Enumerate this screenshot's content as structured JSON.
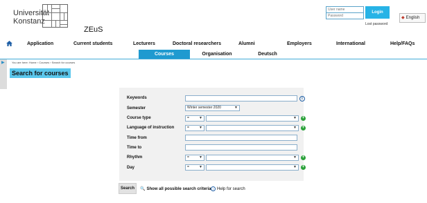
{
  "header": {
    "logo_line1": "Universität",
    "logo_line2": "Konstanz",
    "app_title": "ZEuS",
    "login": {
      "username_placeholder": "User name",
      "password_placeholder": "Password",
      "login_label": "Login",
      "lost_password": "Lost password"
    },
    "language": "English"
  },
  "nav": {
    "home_icon": "home-icon",
    "items": [
      "Application",
      "Current students",
      "Lecturers",
      "Doctoral researchers",
      "Alumni",
      "Employers",
      "International",
      "Help/FAQs"
    ]
  },
  "subnav": {
    "tabs": [
      "Courses",
      "Organisation",
      "Deutsch"
    ],
    "active": "Courses"
  },
  "breadcrumb": "You are here:  Home  ›  Courses  ›  Search for courses",
  "page_title": "Search for courses",
  "form": {
    "labels": {
      "keywords": "Keywords",
      "semester": "Semester",
      "course_type": "Course type",
      "language": "Language of instruction",
      "time_from": "Time from",
      "time_to": "Time to",
      "rhythm": "Rhythm",
      "day": "Day"
    },
    "semester_value": "Winter semester 2020",
    "operator_value": "=",
    "keywords_value": "",
    "time_from_value": "",
    "time_to_value": ""
  },
  "actions": {
    "search": "Search",
    "show_all": "Show all possible search criteria",
    "help": "Help for search"
  },
  "colors": {
    "accent": "#1f9ad0",
    "login_button": "#27b3e6",
    "title_bg": "#5bc7ec",
    "plus": "#2aa139"
  }
}
